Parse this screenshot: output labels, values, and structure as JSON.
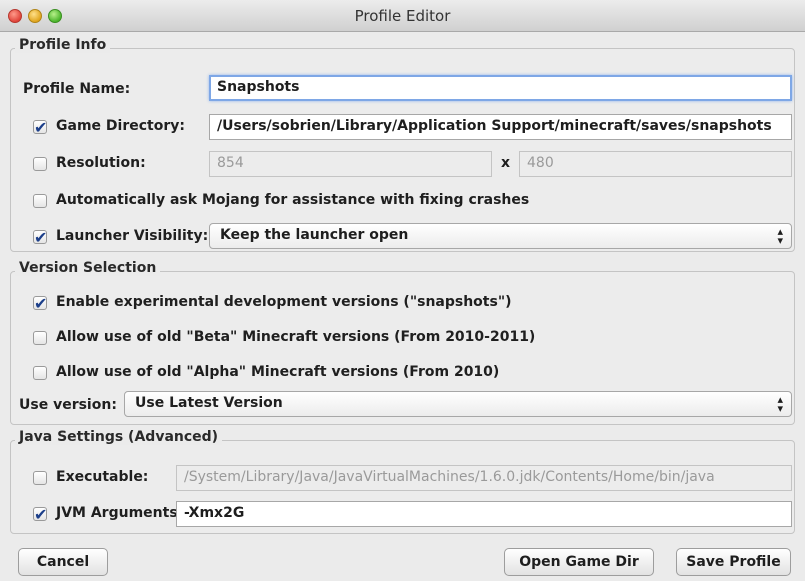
{
  "window": {
    "title": "Profile Editor"
  },
  "profile_info": {
    "legend": "Profile Info",
    "profile_name_label": "Profile Name:",
    "profile_name_value": "Snapshots",
    "game_directory_label": "Game Directory:",
    "game_directory_checked": true,
    "game_directory_value": "/Users/sobrien/Library/Application Support/minecraft/saves/snapshots",
    "resolution_label": "Resolution:",
    "resolution_checked": false,
    "resolution_width": "854",
    "resolution_separator": "x",
    "resolution_height": "480",
    "crash_assist_label": "Automatically ask Mojang for assistance with fixing crashes",
    "crash_assist_checked": false,
    "launcher_visibility_label": "Launcher Visibility:",
    "launcher_visibility_checked": true,
    "launcher_visibility_value": "Keep the launcher open"
  },
  "version_selection": {
    "legend": "Version Selection",
    "snapshots_label": "Enable experimental development versions (\"snapshots\")",
    "snapshots_checked": true,
    "beta_label": "Allow use of old \"Beta\" Minecraft versions (From 2010-2011)",
    "beta_checked": false,
    "alpha_label": "Allow use of old \"Alpha\" Minecraft versions (From 2010)",
    "alpha_checked": false,
    "use_version_label": "Use version:",
    "use_version_value": "Use Latest Version"
  },
  "java_settings": {
    "legend": "Java Settings (Advanced)",
    "executable_label": "Executable:",
    "executable_checked": false,
    "executable_value": "/System/Library/Java/JavaVirtualMachines/1.6.0.jdk/Contents/Home/bin/java",
    "jvm_label": "JVM Arguments:",
    "jvm_checked": true,
    "jvm_value": "-Xmx2G"
  },
  "buttons": {
    "cancel": "Cancel",
    "open_game_dir": "Open Game Dir",
    "save_profile": "Save Profile"
  },
  "icons": {
    "select_arrows": "▴▾",
    "checkmark": "✔"
  }
}
